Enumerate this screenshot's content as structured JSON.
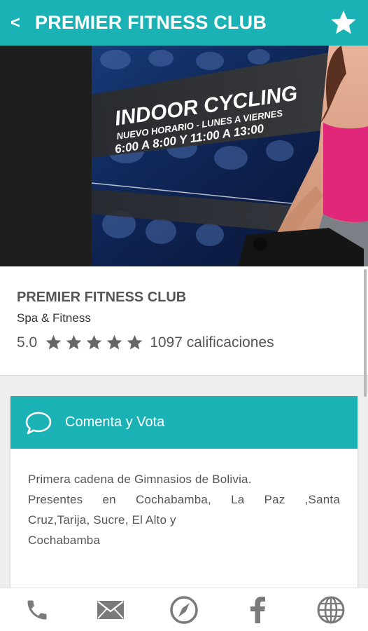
{
  "appbar": {
    "back_label": "<",
    "title": "PREMIER FITNESS CLUB"
  },
  "banner": {
    "headline": "INDOOR CYCLING",
    "line1": "NUEVO HORARIO - LUNES A VIERNES",
    "line2": "6:00 A 8:00 Y 11:00 A 13:00"
  },
  "business": {
    "name": "PREMIER FITNESS CLUB",
    "category": "Spa & Fitness",
    "rating_value": "5.0",
    "rating_stars": 5,
    "rating_count": "1097 calificaciones"
  },
  "comment": {
    "title": "Comenta y Vota",
    "description": {
      "line1": "Primera cadena de Gimnasios de Bolivia.",
      "line2_words": [
        "Presentes",
        "en",
        "Cochabamba,",
        "La",
        "Paz",
        ",Santa"
      ],
      "line3": "Cruz,Tarija, Sucre, El Alto y",
      "line4": "Cochabamba"
    }
  },
  "colors": {
    "accent": "#1ab2b4",
    "icon": "#7a7a7a"
  },
  "bottom_nav": [
    "phone-icon",
    "mail-icon",
    "compass-icon",
    "facebook-icon",
    "globe-icon"
  ]
}
